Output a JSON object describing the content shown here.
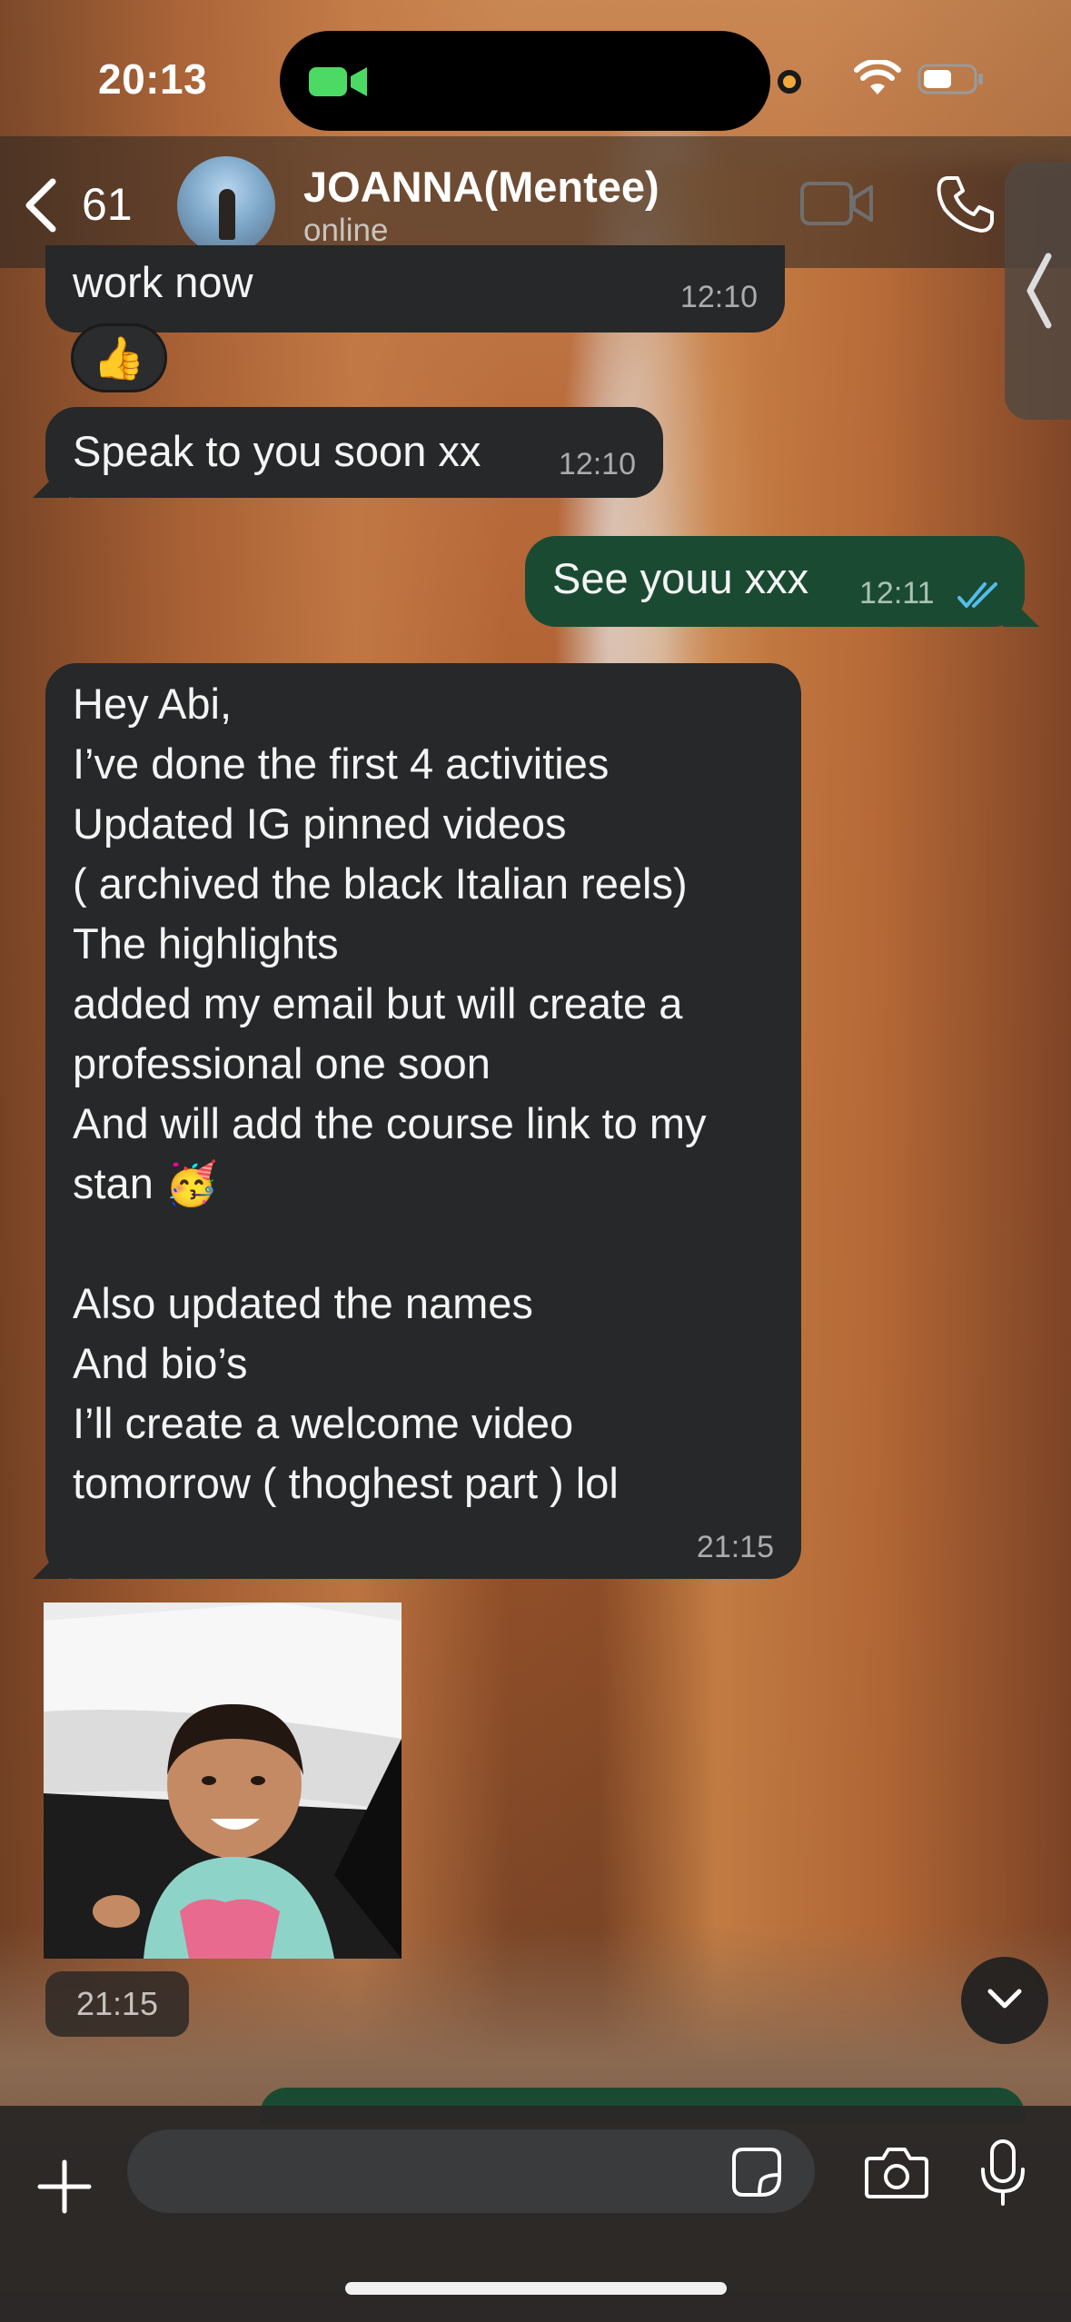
{
  "status_bar": {
    "time": "20:13"
  },
  "header": {
    "back_count": "61",
    "contact_name": "JOANNA(Mentee)",
    "contact_status": "online"
  },
  "messages": [
    {
      "direction": "in",
      "text": "work now",
      "time": "12:10"
    },
    {
      "direction": "in",
      "reaction": "👍"
    },
    {
      "direction": "in",
      "text": "Speak to you soon xx",
      "time": "12:10"
    },
    {
      "direction": "out",
      "text": "See youu xxx",
      "time": "12:11",
      "status": "read"
    },
    {
      "direction": "in",
      "text": "Hey Abi,\nI’ve done the first 4 activities\nUpdated IG pinned videos\n( archived the black Italian reels)\nThe highlights\nadded my email but will create a\nprofessional one soon\nAnd will add the course link to my\nstan 🥳\n\nAlso updated the names\nAnd bio’s\nI’ll create a welcome video\ntomorrow ( thoghest part ) lol",
      "time": "21:15"
    },
    {
      "direction": "in",
      "type": "video",
      "time": "21:15"
    }
  ],
  "input_bar": {
    "placeholder": ""
  },
  "colors": {
    "incoming_bubble": "#262829",
    "outgoing_bubble": "#1b4a33",
    "read_ticks": "#53bdeb",
    "camera_indicator": "#4cd964"
  }
}
